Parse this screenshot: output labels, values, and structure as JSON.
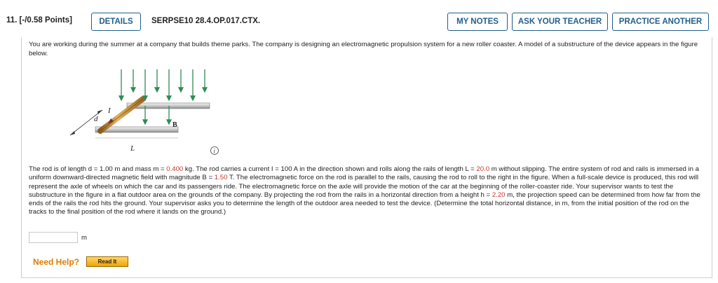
{
  "question": {
    "number_points": "11. [-/0.58 Points]",
    "code": "SERPSE10 28.4.OP.017.CTX."
  },
  "buttons": {
    "details": "DETAILS",
    "my_notes": "MY NOTES",
    "ask_teacher": "ASK YOUR TEACHER",
    "practice": "PRACTICE ANOTHER"
  },
  "intro": "You are working during the summer at a company that builds theme parks. The company is designing an electromagnetic propulsion system for a new roller coaster. A model of a substructure of the device appears in the figure below.",
  "figure": {
    "label_d": "d",
    "label_I": "I",
    "label_B": "B",
    "label_L": "L",
    "info_glyph": "i"
  },
  "problem": {
    "p1": "The rod is of length d = 1.00 m and mass m = ",
    "mass": "0.400",
    "p2": " kg. The rod carries a current I = 100 A in the direction shown and rolls along the rails of length L = ",
    "length": "20.0",
    "p3": " m without slipping. The entire system of rod and rails is immersed in a uniform downward-directed magnetic field with magnitude B = ",
    "field": "1.50",
    "p4": " T. The electromagnetic force on the rod is parallel to the rails, causing the rod to roll to the right in the figure. When a full-scale device is produced, this rod will represent the axle of wheels on which the car and its passengers ride. The electromagnetic force on the axle will provide the motion of the car at the beginning of the roller-coaster ride. Your supervisor wants to test the substructure in the figure in a flat outdoor area on the grounds of the company. By projecting the rod from the rails in a horizontal direction from a height h = ",
    "height": "2.20",
    "p5": " m, the projection speed can be determined from how far from the ends of the rails the rod hits the ground. Your supervisor asks you to determine the length of the outdoor area needed to test the device. (Determine the total horizontal distance, in m, from the initial position of the rod on the tracks to the final position of the rod where it lands on the ground.)"
  },
  "answer": {
    "value": "",
    "unit": "m"
  },
  "help": {
    "need_help": "Need Help?",
    "read_it": "Read It"
  }
}
